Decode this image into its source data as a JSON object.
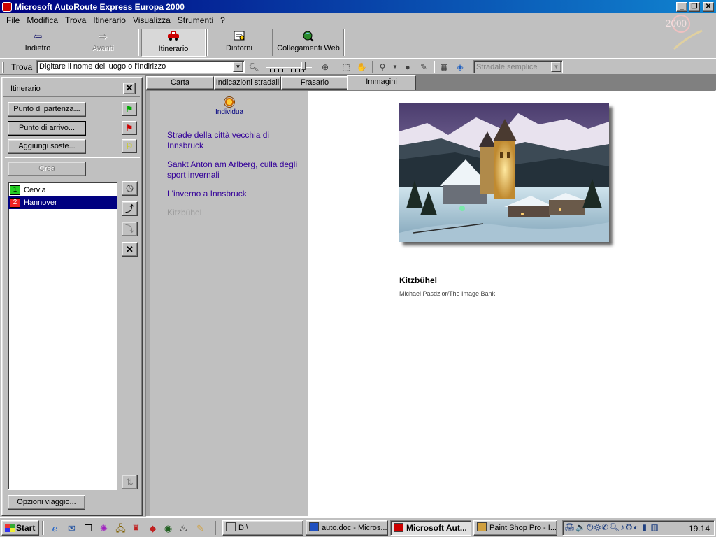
{
  "window": {
    "title": "Microsoft AutoRoute Express Europa 2000",
    "controls": [
      "_",
      "❐",
      "✕"
    ]
  },
  "menu": [
    "File",
    "Modifica",
    "Trova",
    "Itinerario",
    "Visualizza",
    "Strumenti",
    "?"
  ],
  "toolbar": {
    "back": "Indietro",
    "forward": "Avanti",
    "itinerary": "Itinerario",
    "nearby": "Dintorni",
    "weblinks": "Collegamenti Web"
  },
  "find": {
    "label": "Trova",
    "input_value": "Digitare il nome del luogo o l'indirizzo",
    "map_style": "Stradale semplice",
    "zoom_level": 0.85
  },
  "itinerary_panel": {
    "title": "Itinerario",
    "start_button": "Punto di partenza...",
    "end_button": "Punto di arrivo...",
    "stops_button": "Aggiungi soste...",
    "create_button": "Crea",
    "options_button": "Opzioni viaggio...",
    "stops": [
      {
        "num": "1",
        "name": "Cervia",
        "color": "#22cc22"
      },
      {
        "num": "2",
        "name": "Hannover",
        "color": "#ee2222"
      }
    ]
  },
  "tabs": [
    "Carta",
    "Indicazioni stradali",
    "Frasario",
    "Immagini"
  ],
  "content": {
    "locate_label": "Individua",
    "links": [
      "Strade della città vecchia di Innsbruck",
      "Sankt Anton am Arlberg, culla degli sport invernali",
      "L'inverno a Innsbruck",
      "Kitzbühel"
    ],
    "photo_title": "Kitzbühel",
    "photo_credit": "Michael Pasdzior/The Image Bank"
  },
  "taskbar": {
    "start": "Start",
    "tasks": [
      {
        "label": "D:\\",
        "color": "#c0c0c0"
      },
      {
        "label": "auto.doc - Micros...",
        "color": "#2050c0"
      },
      {
        "label": "Microsoft Aut...",
        "color": "#cc0000"
      },
      {
        "label": "Paint Shop Pro - I...",
        "color": "#d0a040"
      }
    ],
    "clock": "19.14"
  }
}
